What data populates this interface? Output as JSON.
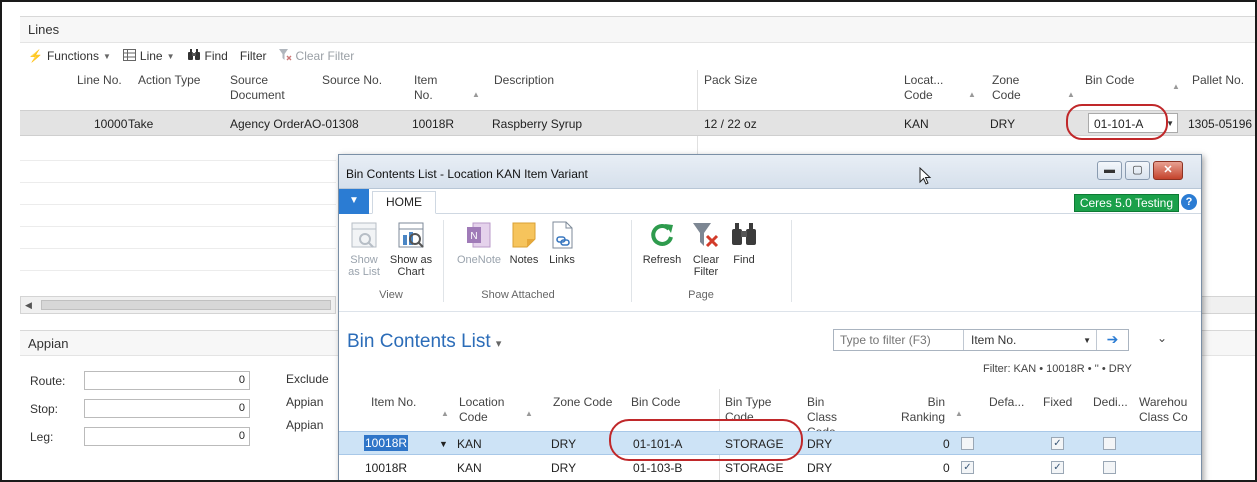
{
  "lines": {
    "caption": "Lines",
    "toolbar": {
      "functions": "Functions",
      "line": "Line",
      "find": "Find",
      "filter": "Filter",
      "clear_filter": "Clear Filter"
    },
    "columns": {
      "line_no": "Line No.",
      "action_type": "Action Type",
      "source_document": "Source Document",
      "source_no": "Source No.",
      "item_no": "Item No.",
      "description": "Description",
      "pack_size": "Pack Size",
      "location_code": "Locat... Code",
      "zone_code": "Zone Code",
      "bin_code": "Bin Code",
      "pallet_no": "Pallet No."
    },
    "row": {
      "line_no": "10000",
      "action_type": "Take",
      "source_document": "Agency Order",
      "source_no": "AO-01308",
      "item_no": "10018R",
      "description": "Raspberry Syrup",
      "pack_size": "12 / 22 oz",
      "location_code": "KAN",
      "zone_code": "DRY",
      "bin_code": "01-101-A",
      "pallet_no": "1305-05196"
    }
  },
  "appian": {
    "caption": "Appian",
    "route_label": "Route:",
    "route_value": "0",
    "stop_label": "Stop:",
    "stop_value": "0",
    "leg_label": "Leg:",
    "leg_value": "0",
    "right_label_1": "Exclude",
    "right_label_2": "Appian",
    "right_label_3": "Appian"
  },
  "dialog": {
    "title": "Bin Contents List - Location KAN Item Variant",
    "tab_home": "HOME",
    "badge": "Ceres 5.0 Testing",
    "help": "?",
    "ribbon": {
      "show_as_list": "Show as List",
      "show_as_chart": "Show as Chart",
      "group_view": "View",
      "onenote": "OneNote",
      "notes": "Notes",
      "links": "Links",
      "group_show_attached": "Show Attached",
      "refresh": "Refresh",
      "clear_filter": "Clear Filter",
      "find": "Find",
      "group_page": "Page"
    },
    "list_title": "Bin Contents List",
    "filter_placeholder": "Type to filter (F3)",
    "filter_field": "Item No.",
    "filter_text": "Filter: KAN • 10018R • '' • DRY",
    "columns": {
      "item_no": "Item No.",
      "location_code": "Location Code",
      "zone_code": "Zone Code",
      "bin_code": "Bin Code",
      "bin_type_code": "Bin Type Code",
      "bin_class_code": "Bin Class Code",
      "bin_ranking": "Bin Ranking",
      "default": "Defa...",
      "fixed": "Fixed",
      "dedicated": "Dedi...",
      "warehouse_class": "Warehou Class Co"
    },
    "rows": [
      {
        "item_no": "10018R",
        "location": "KAN",
        "zone": "DRY",
        "bin": "01-101-A",
        "bin_type": "STORAGE",
        "bin_class": "DRY",
        "ranking": "0",
        "default": false,
        "fixed": true,
        "dedicated": false
      },
      {
        "item_no": "10018R",
        "location": "KAN",
        "zone": "DRY",
        "bin": "01-103-B",
        "bin_type": "STORAGE",
        "bin_class": "DRY",
        "ranking": "0",
        "default": true,
        "fixed": true,
        "dedicated": false
      }
    ]
  },
  "colors": {
    "accent_blue": "#2b7cd3",
    "highlight_red": "#c0282a",
    "badge_green": "#1aa04a",
    "selected_row": "#cde3f6"
  }
}
